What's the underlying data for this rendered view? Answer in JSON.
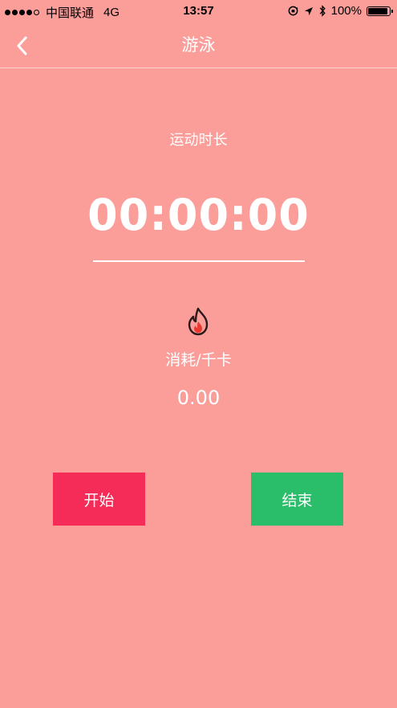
{
  "status_bar": {
    "carrier": "中国联通",
    "network": "4G",
    "time": "13:57",
    "battery_text": "100%",
    "battery_level": 1.0
  },
  "nav": {
    "title": "游泳",
    "back_icon": "chevron-left-icon"
  },
  "workout": {
    "duration_label": "运动时长",
    "duration_value": "00:00:00",
    "flame_icon": "flame-icon",
    "calories_label": "消耗/千卡",
    "calories_value": "0.00"
  },
  "actions": {
    "start_label": "开始",
    "end_label": "结束"
  },
  "colors": {
    "background": "#fb9e9a",
    "start_button": "#f52c57",
    "end_button": "#2bbe6a",
    "flame_outline": "#2a1a1a",
    "flame_fill": "#e8382f"
  }
}
